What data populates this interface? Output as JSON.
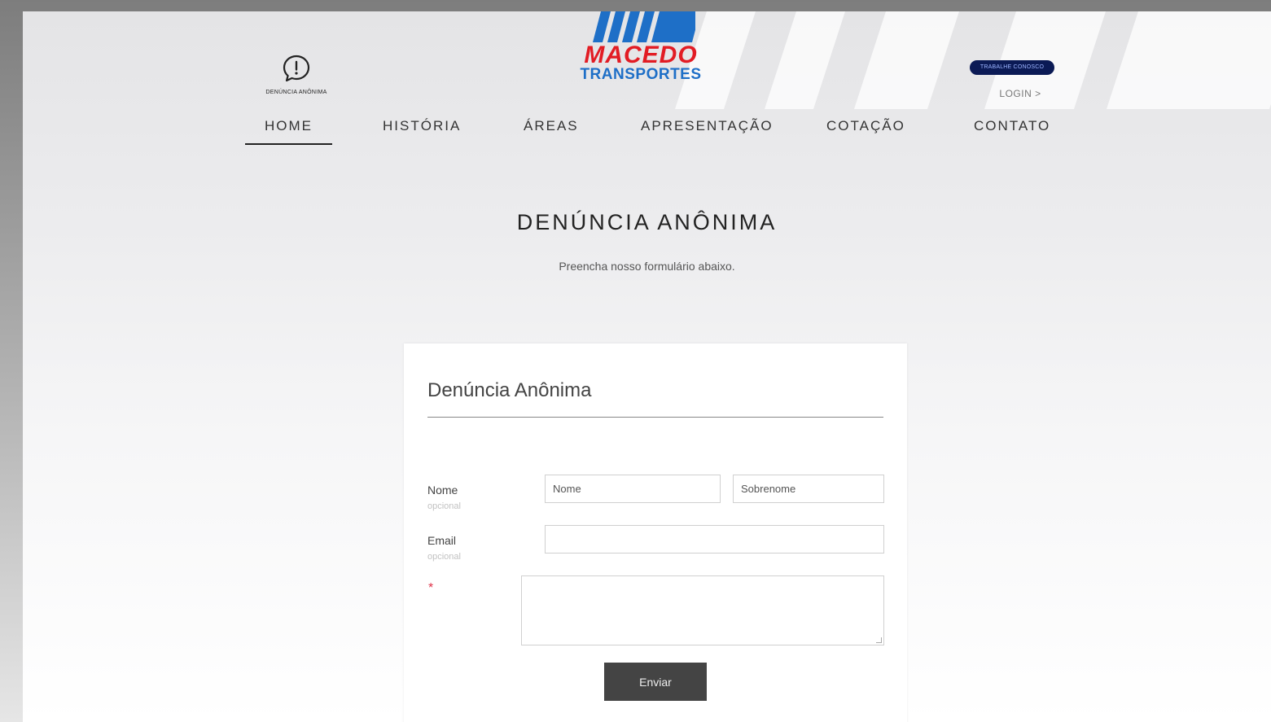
{
  "brand": {
    "name": "MACEDO",
    "subtitle": "TRANSPORTES",
    "colors": {
      "red": "#e21c24",
      "blue": "#1e6fc7"
    }
  },
  "header": {
    "report_link": {
      "icon": "speech-bubble-exclamation-icon",
      "label": "DENÚNCIA ANÔNIMA"
    },
    "work_with_us": "TRABALHE CONOSCO",
    "login": "LOGIN >"
  },
  "nav": {
    "items": [
      {
        "label": "HOME",
        "active": true
      },
      {
        "label": "HISTÓRIA"
      },
      {
        "label": "ÁREAS"
      },
      {
        "label": "APRESENTAÇÃO"
      },
      {
        "label": "COTAÇÃO"
      },
      {
        "label": "CONTATO"
      }
    ]
  },
  "page": {
    "title": "DENÚNCIA ANÔNIMA",
    "subtitle": "Preencha nosso formulário abaixo."
  },
  "form": {
    "title": "Denúncia Anônima",
    "name_label": "Nome",
    "name_note": "opcional",
    "first_name_placeholder": "Nome",
    "last_name_placeholder": "Sobrenome",
    "email_label": "Email",
    "email_note": "opcional",
    "email_value": "",
    "message_required_mark": "*",
    "message_value": "",
    "submit_label": "Enviar"
  }
}
